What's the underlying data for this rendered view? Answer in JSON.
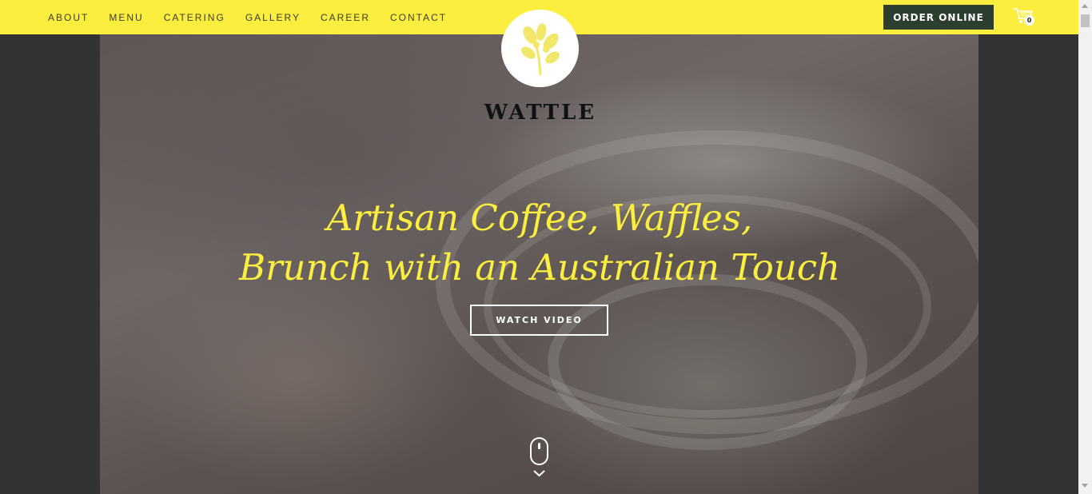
{
  "nav": {
    "items": [
      "ABOUT",
      "MENU",
      "CATERING",
      "GALLERY",
      "CAREER",
      "CONTACT"
    ]
  },
  "header": {
    "order_label": "ORDER ONLINE",
    "cart_icon": "shopping-cart-icon",
    "cart_count": "0"
  },
  "brand": {
    "logo_icon": "wattle-flower-icon",
    "name": "WATTLE"
  },
  "hero": {
    "headline_line1": "Artisan Coffee, Waffles,",
    "headline_line2": "Brunch with an Australian Touch",
    "watch_label": "WATCH VIDEO",
    "scroll_icon": "mouse-scroll-icon",
    "chevron_icon": "chevron-down-icon"
  },
  "colors": {
    "accent_yellow": "#fbee3f",
    "order_button": "#2c3f2e",
    "page_background": "#333333"
  }
}
